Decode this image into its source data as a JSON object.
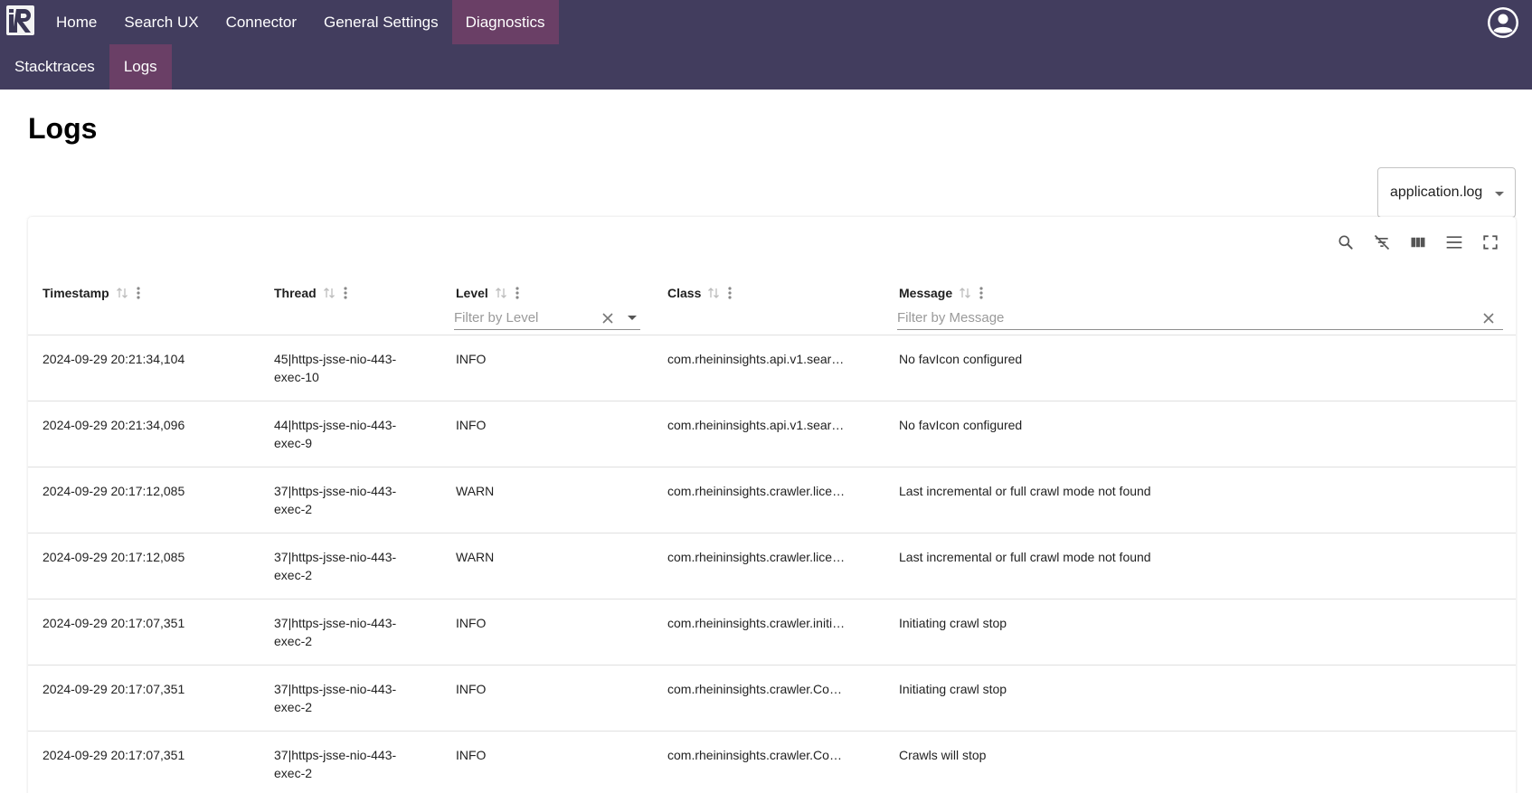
{
  "nav": {
    "main": [
      {
        "label": "Home",
        "active": false
      },
      {
        "label": "Search UX",
        "active": false
      },
      {
        "label": "Connector",
        "active": false
      },
      {
        "label": "General Settings",
        "active": false
      },
      {
        "label": "Diagnostics",
        "active": true
      }
    ],
    "sub": [
      {
        "label": "Stacktraces",
        "active": false
      },
      {
        "label": "Logs",
        "active": true
      }
    ],
    "account_icon": "account-circle-icon"
  },
  "page": {
    "title": "Logs"
  },
  "log_file_select": {
    "value": "application.log"
  },
  "toolbar": {
    "icons": [
      "search-icon",
      "filter-off-icon",
      "columns-icon",
      "density-icon",
      "fullscreen-icon"
    ]
  },
  "table": {
    "columns": {
      "timestamp": "Timestamp",
      "thread": "Thread",
      "level": "Level",
      "class": "Class",
      "message": "Message"
    },
    "filters": {
      "level_placeholder": "Filter by Level",
      "message_placeholder": "Filter by Message"
    },
    "rows": [
      {
        "timestamp": "2024-09-29 20:21:34,104",
        "thread_a": "45|https-jsse-nio-443-",
        "thread_b": "exec-10",
        "level": "INFO",
        "class": "com.rheininsights.api.v1.sear…",
        "message": "No favIcon configured"
      },
      {
        "timestamp": "2024-09-29 20:21:34,096",
        "thread_a": "44|https-jsse-nio-443-",
        "thread_b": "exec-9",
        "level": "INFO",
        "class": "com.rheininsights.api.v1.sear…",
        "message": "No favIcon configured"
      },
      {
        "timestamp": "2024-09-29 20:17:12,085",
        "thread_a": "37|https-jsse-nio-443-",
        "thread_b": "exec-2",
        "level": "WARN",
        "class": "com.rheininsights.crawler.lice…",
        "message": "Last incremental or full crawl mode not found"
      },
      {
        "timestamp": "2024-09-29 20:17:12,085",
        "thread_a": "37|https-jsse-nio-443-",
        "thread_b": "exec-2",
        "level": "WARN",
        "class": "com.rheininsights.crawler.lice…",
        "message": "Last incremental or full crawl mode not found"
      },
      {
        "timestamp": "2024-09-29 20:17:07,351",
        "thread_a": "37|https-jsse-nio-443-",
        "thread_b": "exec-2",
        "level": "INFO",
        "class": "com.rheininsights.crawler.initi…",
        "message": "Initiating crawl stop"
      },
      {
        "timestamp": "2024-09-29 20:17:07,351",
        "thread_a": "37|https-jsse-nio-443-",
        "thread_b": "exec-2",
        "level": "INFO",
        "class": "com.rheininsights.crawler.Co…",
        "message": "Initiating crawl stop"
      },
      {
        "timestamp": "2024-09-29 20:17:07,351",
        "thread_a": "37|https-jsse-nio-443-",
        "thread_b": "exec-2",
        "level": "INFO",
        "class": "com.rheininsights.crawler.Co…",
        "message": "Crawls will stop"
      }
    ]
  },
  "colors": {
    "topbar": "#423d5e",
    "active_tab": "#6a3f66"
  }
}
